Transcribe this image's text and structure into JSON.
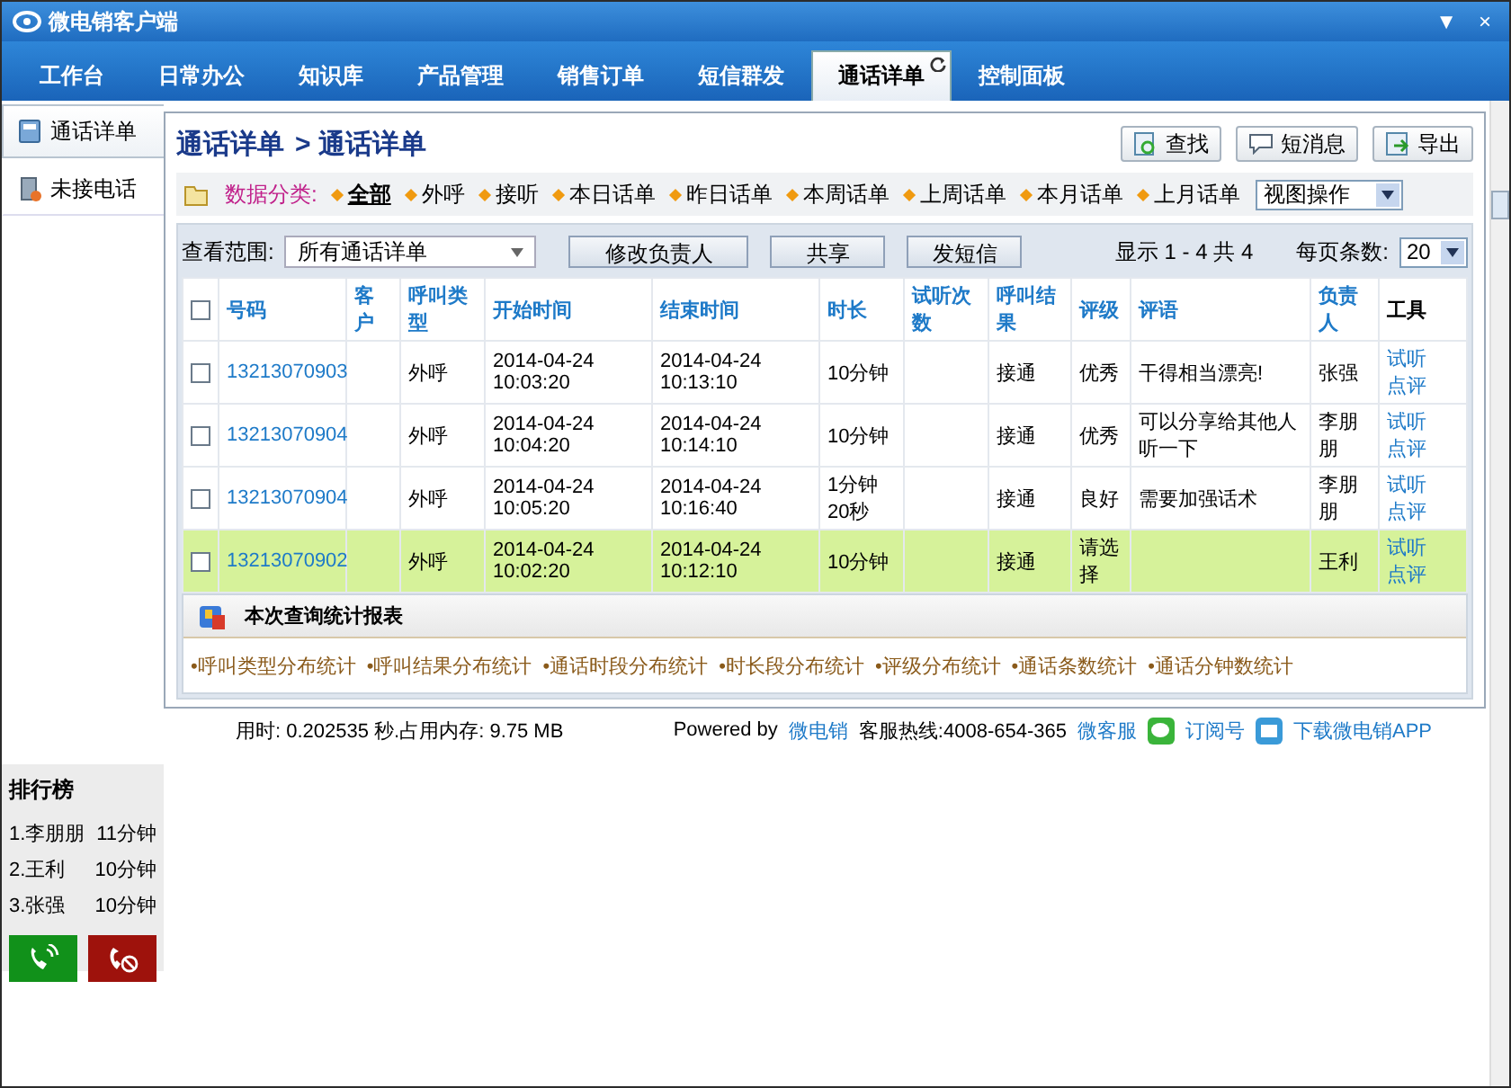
{
  "window": {
    "title": "微电销客户端",
    "controls": [
      "▼",
      "×"
    ]
  },
  "nav_tabs": [
    {
      "label": "工作台",
      "selected": false
    },
    {
      "label": "日常办公",
      "selected": false
    },
    {
      "label": "知识库",
      "selected": false
    },
    {
      "label": "产品管理",
      "selected": false
    },
    {
      "label": "销售订单",
      "selected": false
    },
    {
      "label": "短信群发",
      "selected": false
    },
    {
      "label": "通话详单",
      "selected": true
    },
    {
      "label": "控制面板",
      "selected": false
    }
  ],
  "sidebar": {
    "items": [
      {
        "label": "通话详单",
        "selected": true
      },
      {
        "label": "未接电话",
        "selected": false
      }
    ]
  },
  "breadcrumb": {
    "parent": "通话详单",
    "separator": ">",
    "current": "通话详单"
  },
  "toolbar_buttons": [
    {
      "label": "查找",
      "kind": "search"
    },
    {
      "label": "短消息",
      "kind": "message"
    },
    {
      "label": "导出",
      "kind": "export"
    }
  ],
  "filter": {
    "label": "数据分类:",
    "options": [
      {
        "label": "全部",
        "selected": true
      },
      {
        "label": "外呼",
        "selected": false
      },
      {
        "label": "接听",
        "selected": false
      },
      {
        "label": "本日话单",
        "selected": false
      },
      {
        "label": "昨日话单",
        "selected": false
      },
      {
        "label": "本周话单",
        "selected": false
      },
      {
        "label": "上周话单",
        "selected": false
      },
      {
        "label": "本月话单",
        "selected": false
      },
      {
        "label": "上月话单",
        "selected": false
      }
    ],
    "view_select": "视图操作"
  },
  "list_controls": {
    "scope_label": "查看范围:",
    "scope_value": "所有通话详单",
    "buttons": [
      "修改负责人",
      "共享",
      "发短信"
    ],
    "paging": "显示 1 - 4 共 4",
    "page_size_label": "每页条数:",
    "page_size": "20"
  },
  "table": {
    "select_all_checked": false,
    "columns": [
      "号码",
      "客户",
      "呼叫类型",
      "开始时间",
      "结束时间",
      "时长",
      "试听次数",
      "呼叫结果",
      "评级",
      "评语",
      "负责人",
      "工具"
    ],
    "rows": [
      {
        "checked": false,
        "selected": false,
        "number": "13213070903",
        "call_type": "外呼",
        "start": "2014-04-24 10:03:20",
        "end": "2014-04-24 10:13:10",
        "duration": "10分钟",
        "result": "接通",
        "rating": "优秀",
        "comment": "干得相当漂亮!",
        "owner": "张强",
        "tools": [
          "试听",
          "点评"
        ]
      },
      {
        "checked": false,
        "selected": false,
        "number": "13213070904",
        "call_type": "外呼",
        "start": "2014-04-24 10:04:20",
        "end": "2014-04-24 10:14:10",
        "duration": "10分钟",
        "result": "接通",
        "rating": "优秀",
        "comment": "可以分享给其他人听一下",
        "owner": "李朋朋",
        "tools": [
          "试听",
          "点评"
        ]
      },
      {
        "checked": false,
        "selected": false,
        "number": "13213070904",
        "call_type": "外呼",
        "start": "2014-04-24 10:05:20",
        "end": "2014-04-24 10:16:40",
        "duration": "1分钟20秒",
        "result": "接通",
        "rating": "良好",
        "comment": "需要加强话术",
        "owner": "李朋朋",
        "tools": [
          "试听",
          "点评"
        ]
      },
      {
        "checked": false,
        "selected": true,
        "number": "13213070902",
        "call_type": "外呼",
        "start": "2014-04-24 10:02:20",
        "end": "2014-04-24 10:12:10",
        "duration": "10分钟",
        "result": "接通",
        "rating": "请选择",
        "comment": "",
        "owner": "王利",
        "tools": [
          "试听",
          "点评"
        ]
      }
    ]
  },
  "report": {
    "title": "本次查询统计报表",
    "links": [
      "•呼叫类型分布统计",
      "•呼叫结果分布统计",
      "•通话时段分布统计",
      "•时长段分布统计",
      "•评级分布统计",
      "•通话条数统计",
      "•通话分钟数统计"
    ]
  },
  "footer": {
    "stats": "用时: 0.202535 秒.占用内存: 9.75 MB",
    "powered_by": "Powered by",
    "brand": "微电销",
    "hotline": "客服热线:4008-654-365",
    "links": [
      {
        "label": "微客服",
        "kind": "plain"
      },
      {
        "label": "订阅号",
        "kind": "wechat"
      },
      {
        "label": "下载微电销APP",
        "kind": "app"
      }
    ]
  },
  "leaderboard": {
    "title": "排行榜",
    "entries": [
      {
        "name": "1.李朋朋",
        "minutes": "11分钟"
      },
      {
        "name": "2.王利",
        "minutes": "10分钟"
      },
      {
        "name": "3.张强",
        "minutes": "10分钟"
      }
    ]
  }
}
